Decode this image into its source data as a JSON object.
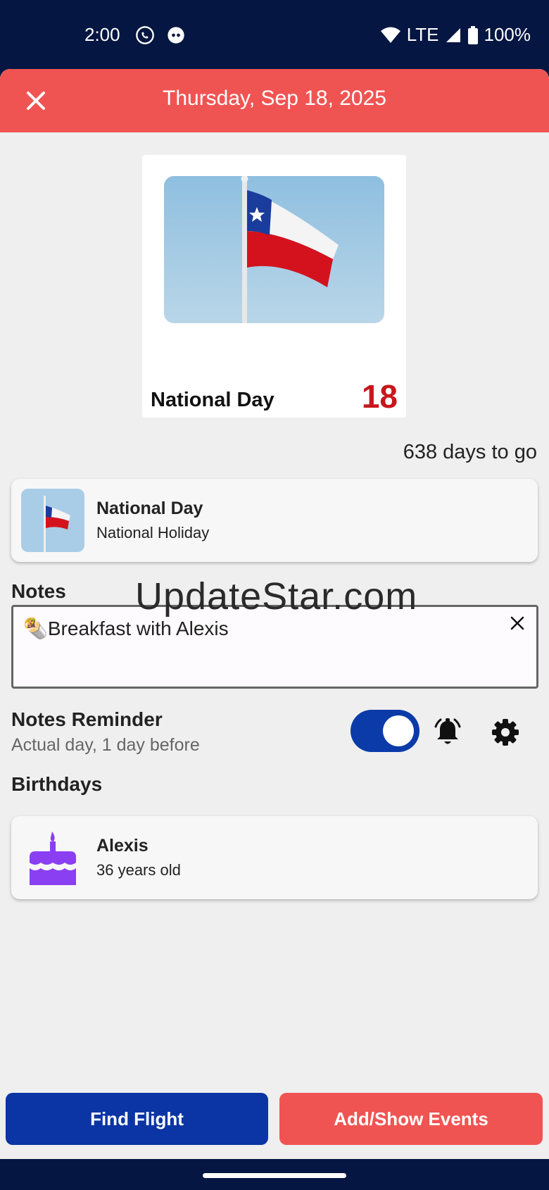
{
  "status_bar": {
    "time": "2:00",
    "network": "LTE",
    "battery": "100%"
  },
  "header": {
    "title": "Thursday, Sep 18, 2025",
    "color": "#f05452"
  },
  "featured": {
    "title": "National Day",
    "day_number": "18"
  },
  "countdown": "638 days to go",
  "holiday": {
    "title": "National Day",
    "subtitle": "National Holiday"
  },
  "notes": {
    "label": "Notes",
    "text": "Breakfast with Alexis"
  },
  "watermark": "UpdateStar.com",
  "reminder": {
    "title": "Notes Reminder",
    "subtitle": "Actual day, 1 day before",
    "enabled": true
  },
  "birthdays": {
    "label": "Birthdays",
    "items": [
      {
        "name": "Alexis",
        "age": "36 years old"
      }
    ]
  },
  "actions": {
    "find_flight": "Find Flight",
    "add_show_events": "Add/Show Events"
  },
  "colors": {
    "primary_blue": "#0b35a4",
    "accent_red": "#f05452",
    "date_red": "#c8161d",
    "cake_purple": "#8b3ff2"
  }
}
